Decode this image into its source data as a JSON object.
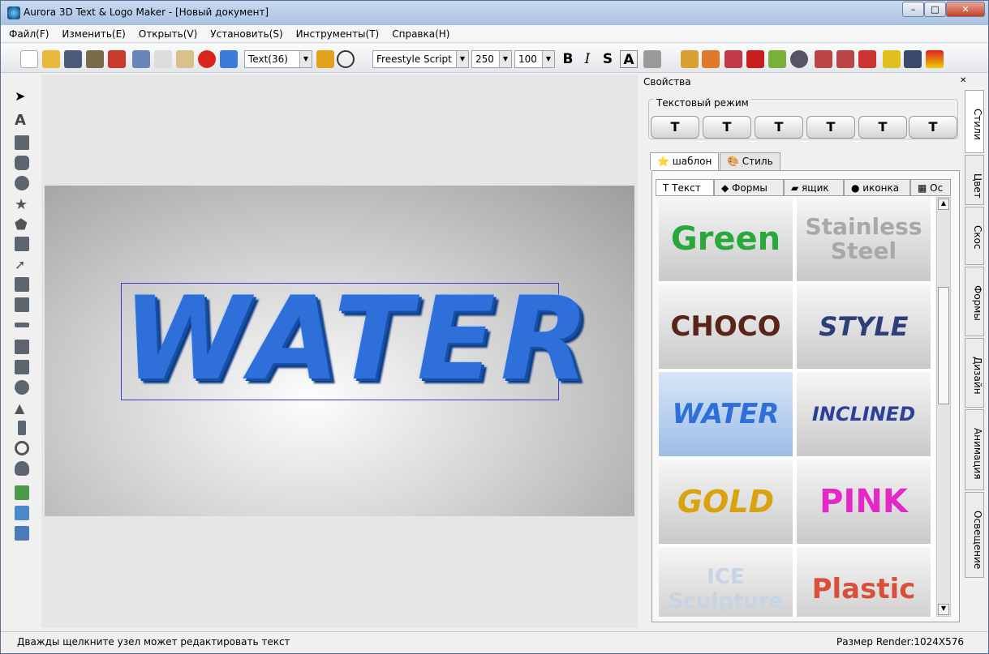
{
  "window": {
    "title": "Aurora 3D Text & Logo Maker - [Новый документ]"
  },
  "menu": [
    "Файл(F)",
    "Изменить(E)",
    "Открыть(V)",
    "Установить(S)",
    "Инструменты(T)",
    "Справка(H)"
  ],
  "toolbar": {
    "object_select": "Text(36)",
    "font_select": "Freestyle Script",
    "size1": "250",
    "size2": "100",
    "bold": "B",
    "italic": "I",
    "strike": "S",
    "outline": "A"
  },
  "canvas": {
    "text": "WATER"
  },
  "props": {
    "header": "Свойства",
    "mode_label": "Текстовый режим",
    "tabs": [
      "шаблон",
      "Стиль"
    ],
    "subtabs": [
      "Текст",
      "Формы",
      "ящик",
      "иконка",
      "Ос"
    ]
  },
  "styles": [
    {
      "label": "Green",
      "color": "#2aa83a"
    },
    {
      "label": "Stainless Steel",
      "color": "#a8a8a8"
    },
    {
      "label": "CHOCO",
      "color": "#5a2418"
    },
    {
      "label": "STYLE",
      "color": "#2d3f7a"
    },
    {
      "label": "WATER",
      "color": "#2f6fd9"
    },
    {
      "label": "INCLINED",
      "color": "#2c3f9c"
    },
    {
      "label": "GOLD",
      "color": "#d9a30e"
    },
    {
      "label": "PINK",
      "color": "#e428c8"
    },
    {
      "label": "ICE Sculpture",
      "color": "#c6d4e4"
    },
    {
      "label": "Plastic",
      "color": "#d8503a"
    }
  ],
  "side_tabs": [
    "Стили",
    "Цвет",
    "Скос",
    "Формы",
    "Дизайн",
    "Анимация",
    "Освещение"
  ],
  "status": {
    "left": "Дважды щелкните узел может редактировать текст",
    "right": "Размер Render:1024X576"
  }
}
